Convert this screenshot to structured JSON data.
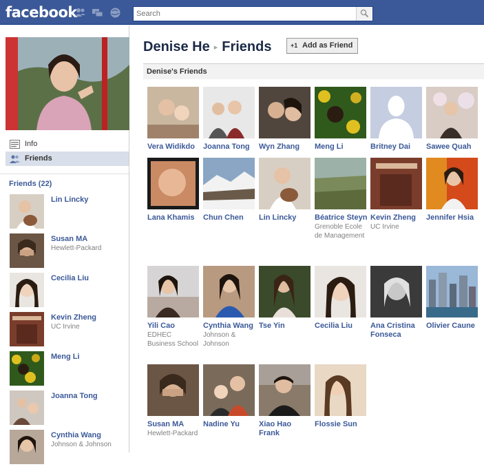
{
  "topbar": {
    "logo": "facebook",
    "search": {
      "placeholder": "Search",
      "value": ""
    },
    "jewels": [
      "friend-requests-icon",
      "messages-icon",
      "notifications-icon"
    ]
  },
  "colors": {
    "brand": "#3b5998",
    "link": "#3b5998",
    "header_bg": "#f2f2f2"
  },
  "sidebar": {
    "nav": [
      {
        "label": "Info",
        "icon": "info-icon",
        "selected": false
      },
      {
        "label": "Friends",
        "icon": "friends-icon",
        "selected": true
      }
    ],
    "friends_title": "Friends (22)",
    "friends": [
      {
        "name": "Lin Lincky",
        "network": ""
      },
      {
        "name": "Susan MA",
        "network": "Hewlett-Packard"
      },
      {
        "name": "Cecilia Liu",
        "network": ""
      },
      {
        "name": "Kevin Zheng",
        "network": "UC Irvine"
      },
      {
        "name": "Meng Li",
        "network": ""
      },
      {
        "name": "Joanna Tong",
        "network": ""
      },
      {
        "name": "Cynthia Wang",
        "network": "Johnson & Johnson"
      }
    ]
  },
  "main": {
    "breadcrumb": {
      "profile": "Denise He",
      "section": "Friends"
    },
    "add_friend": {
      "icon": "+1",
      "label": "Add as Friend"
    },
    "section_title": "Denise's Friends",
    "friends": [
      {
        "name": "Vera Widikdo",
        "network": ""
      },
      {
        "name": "Joanna Tong",
        "network": ""
      },
      {
        "name": "Wyn Zhang",
        "network": ""
      },
      {
        "name": "Meng Li",
        "network": ""
      },
      {
        "name": "Britney Dai",
        "network": ""
      },
      {
        "name": "Sawee Quah",
        "network": ""
      },
      {
        "name": "Lana Khamis",
        "network": ""
      },
      {
        "name": "Chun Chen",
        "network": ""
      },
      {
        "name": "Lin Lincky",
        "network": ""
      },
      {
        "name": "Béatrice Steyn",
        "network": "Grenoble Ecole de Management"
      },
      {
        "name": "Kevin Zheng",
        "network": "UC Irvine"
      },
      {
        "name": "Jennifer Hsia",
        "network": ""
      },
      {
        "name": "Yili Cao",
        "network": "EDHEC Business School"
      },
      {
        "name": "Cynthia Wang",
        "network": "Johnson & Johnson"
      },
      {
        "name": "Tse Yin",
        "network": ""
      },
      {
        "name": "Cecilia Liu",
        "network": ""
      },
      {
        "name": "Ana Cristina Fonseca",
        "network": ""
      },
      {
        "name": "Olivier Caune",
        "network": ""
      },
      {
        "name": "Susan MA",
        "network": "Hewlett-Packard"
      },
      {
        "name": "Nadine Yu",
        "network": ""
      },
      {
        "name": "Xiao Hao Frank",
        "network": ""
      },
      {
        "name": "Flossie Sun",
        "network": ""
      }
    ]
  }
}
